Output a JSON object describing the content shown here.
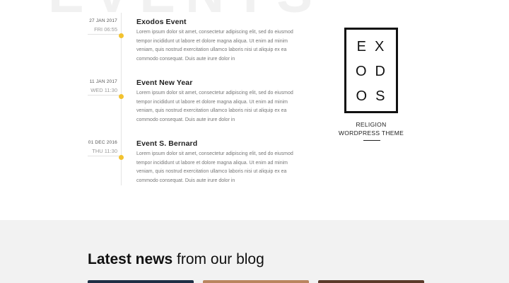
{
  "background_word": "EVENTS",
  "events": [
    {
      "date": "27 JAN 2017",
      "day": "FRI 06:55",
      "title": "Exodos Event",
      "body": "Lorem ipsum dolor sit amet, consectetur adipiscing elit, sed do eiusmod tempor incididunt ut labore et dolore magna aliqua. Ut enim ad minim veniam, quis nostrud exercitation ullamco laboris nisi ut aliquip ex ea commodo consequat. Duis aute irure dolor in"
    },
    {
      "date": "11 JAN 2017",
      "day": "WED 11:30",
      "title": "Event New Year",
      "body": "Lorem ipsum dolor sit amet, consectetur adipiscing elit, sed do eiusmod tempor incididunt ut labore et dolore magna aliqua. Ut enim ad minim veniam, quis nostrud exercitation ullamco laboris nisi ut aliquip ex ea commodo consequat. Duis aute irure dolor in"
    },
    {
      "date": "01 DEC 2016",
      "day": "THU 11:30",
      "title": "Event S. Bernard",
      "body": "Lorem ipsum dolor sit amet, consectetur adipiscing elit, sed do eiusmod tempor incididunt ut labore et dolore magna aliqua. Ut enim ad minim veniam, quis nostrud exercitation ullamco laboris nisi ut aliquip ex ea commodo consequat. Duis aute irure dolor in"
    }
  ],
  "logo": {
    "rows": [
      [
        "E",
        "X"
      ],
      [
        "O",
        "D"
      ],
      [
        "O",
        "S"
      ]
    ],
    "caption_line1": "RELIGION",
    "caption_line2": "WORDPRESS THEME"
  },
  "blog": {
    "heading_bold": "Latest news",
    "heading_rest": " from our blog"
  },
  "colors": {
    "accent": "#f2c230",
    "section_bg": "#f2f2f2",
    "text_dark": "#222222",
    "text_muted": "#777777"
  }
}
